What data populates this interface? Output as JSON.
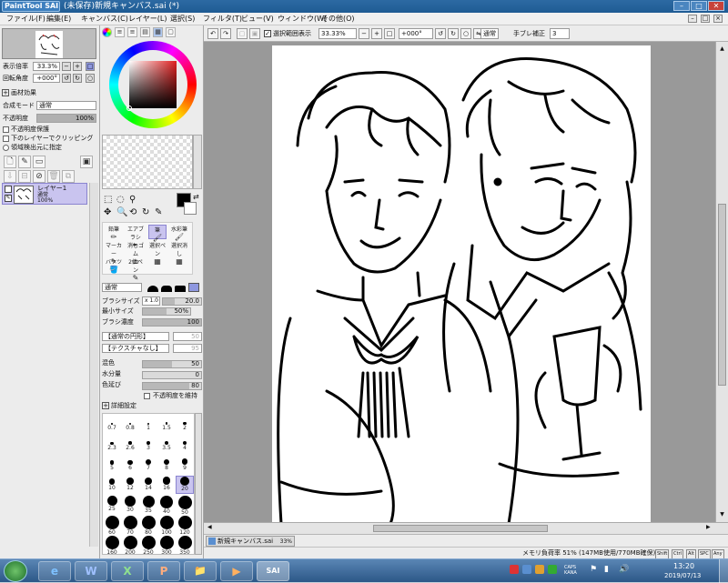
{
  "titlebar": {
    "logo": "PaintTool SAI",
    "title": "(未保存)新規キャンバス.sai (*)",
    "min": "–",
    "max": "□",
    "close": "✕"
  },
  "menu": [
    "ファイル(F)",
    "編集(E)",
    "キャンバス(C)",
    "レイヤー(L)",
    "選択(S)",
    "フィルタ(T)",
    "ビュー(V)",
    "ウィンドウ(W)",
    "その他(O)"
  ],
  "navigator": {
    "zoom_label": "表示倍率",
    "zoom_value": "33.3%",
    "rotate_label": "回転角度",
    "rotate_value": "+000°"
  },
  "layer_panel": {
    "effect_header": "画材効果",
    "blend_label": "合成モード",
    "blend_value": "通常",
    "opacity_label": "不透明度",
    "opacity_value": "100%",
    "check1": "不透明度保護",
    "check2": "下のレイヤーでクリッピング",
    "check3": "領域検出元に指定",
    "layer_name": "レイヤー1",
    "layer_mode": "通常",
    "layer_opacity": "100%"
  },
  "tools": {
    "row1": [
      "鉛筆",
      "エアブラシ",
      "筆",
      "水彩筆"
    ],
    "row2": [
      "マーカー",
      "消しゴム",
      "選択ペン",
      "選択消し"
    ],
    "row3": [
      "バケツ",
      "2値ペン"
    ]
  },
  "brush": {
    "mode_value": "通常",
    "size_label": "ブラシサイズ",
    "size_mult": "x 1.0",
    "size_value": "20.0",
    "min_label": "最小サイズ",
    "min_value": "50%",
    "density_label": "ブラシ濃度",
    "density_value": "100",
    "shape_value": "【通常の円形】",
    "shape_num": "50",
    "texture_value": "【テクスチャなし】",
    "texture_num": "95",
    "blend_label": "混色",
    "blend_value": "50",
    "water_label": "水分量",
    "water_value": "0",
    "stretch_label": "色延び",
    "stretch_value": "80",
    "keep_opacity": "不透明度を維持",
    "detail_header": "詳細設定",
    "sizes": [
      "0.7",
      "0.8",
      "1",
      "1.5",
      "2",
      "2.3",
      "2.6",
      "3",
      "3.5",
      "4",
      "5",
      "6",
      "7",
      "8",
      "9",
      "10",
      "12",
      "14",
      "16",
      "20",
      "25",
      "30",
      "35",
      "40",
      "50",
      "60",
      "70",
      "80",
      "100",
      "120",
      "160",
      "200",
      "250",
      "300",
      "350"
    ]
  },
  "toolbar": {
    "selection_check": "選択範囲表示",
    "zoom": "33.33%",
    "angle": "+000°",
    "mode": "通常",
    "stabilizer_label": "手ブレ補正",
    "stabilizer_value": "3"
  },
  "doc_tab": {
    "name": "新規キャンバス.sai",
    "zoom": "33%"
  },
  "status": {
    "memory": "メモリ負荷率 51% (147MB使用/770MB確保)",
    "keys": [
      "Shift",
      "Ctrl",
      "Alt",
      "SPC",
      "Any"
    ]
  },
  "taskbar": {
    "apps": [
      "e",
      "W",
      "X",
      "P",
      "📁",
      "▶",
      "SAI"
    ],
    "time": "13:20",
    "date": "2019/07/13",
    "ime": "CAPS KANA"
  },
  "colors": {
    "accent": "#2d6aa3",
    "selection": "#c9c4ef",
    "canvas_bg": "#999999"
  }
}
